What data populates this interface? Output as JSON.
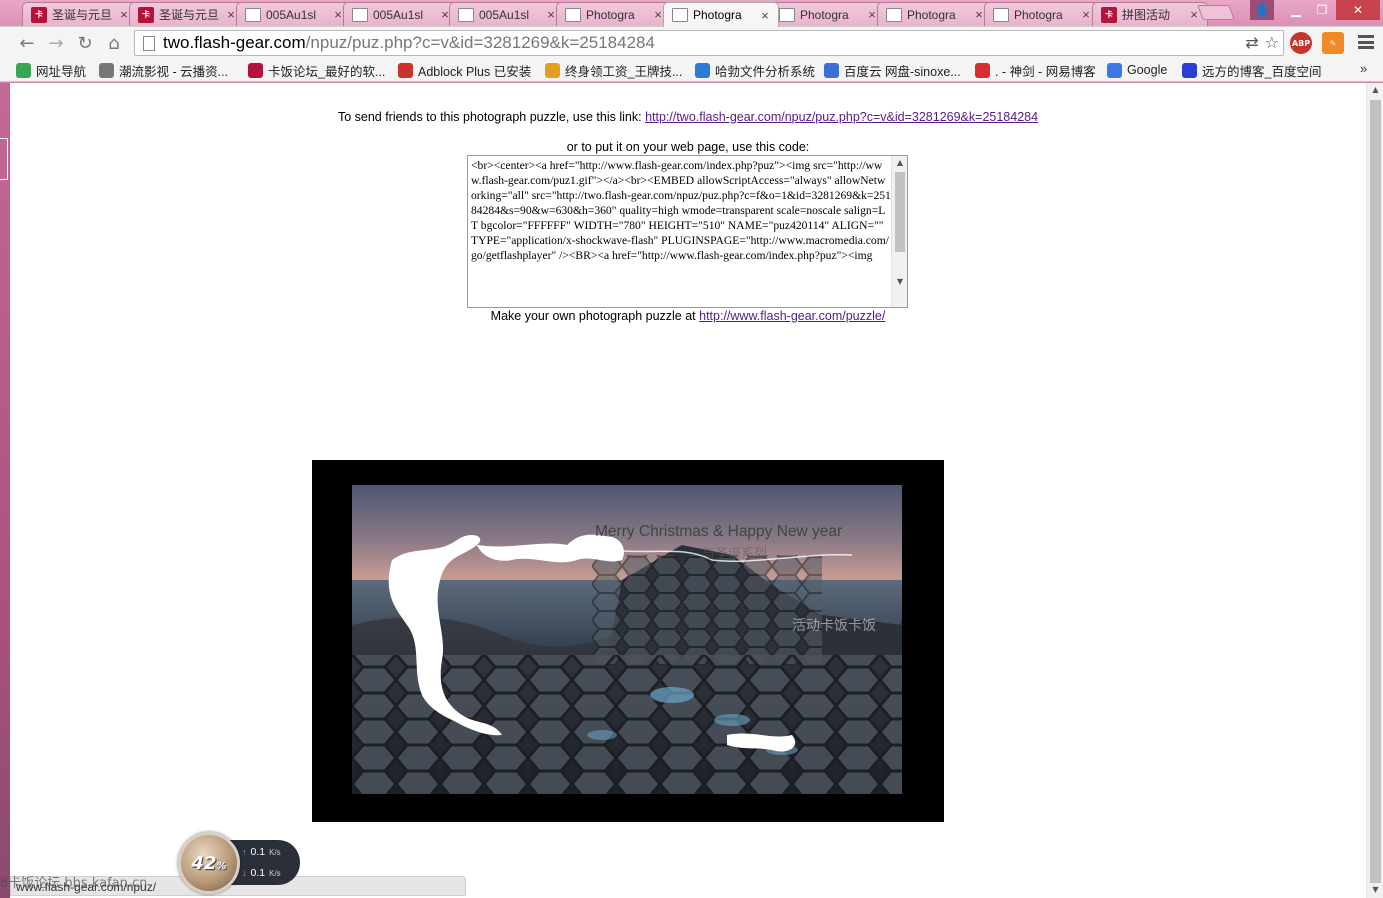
{
  "browser": {
    "tabs": [
      {
        "title": "圣诞与元旦",
        "icon": "red",
        "active": false
      },
      {
        "title": "圣诞与元旦",
        "icon": "red",
        "active": false
      },
      {
        "title": "005Au1sl",
        "icon": "doc",
        "active": false
      },
      {
        "title": "005Au1sl",
        "icon": "doc",
        "active": false
      },
      {
        "title": "005Au1sl",
        "icon": "doc",
        "active": false
      },
      {
        "title": "Photogra",
        "icon": "doc",
        "active": false
      },
      {
        "title": "Photogra",
        "icon": "doc",
        "active": true
      },
      {
        "title": "Photogra",
        "icon": "doc",
        "active": false
      },
      {
        "title": "Photogra",
        "icon": "doc",
        "active": false
      },
      {
        "title": "Photogra",
        "icon": "doc",
        "active": false
      },
      {
        "title": "拼图活动",
        "icon": "red",
        "active": false
      }
    ],
    "tab_close_glyph": "×",
    "address": {
      "host": "two.flash-gear.com",
      "path": "/npuz/puz.php?c=v&id=3281269&k=25184284"
    },
    "bookmarks": [
      {
        "label": "网址导航",
        "icon_color": "#3aa655"
      },
      {
        "label": "潮流影视 - 云播资...",
        "icon_color": "#777777"
      },
      {
        "label": "卡饭论坛_最好的软...",
        "icon_color": "#b3133b"
      },
      {
        "label": "Adblock Plus 已安装",
        "icon_color": "#c8332b"
      },
      {
        "label": "终身领工资_王牌技...",
        "icon_color": "#e0a020"
      },
      {
        "label": "哈勃文件分析系统",
        "icon_color": "#2a7ad6"
      },
      {
        "label": "百度云 网盘-sinoxe...",
        "icon_color": "#3b6fd3"
      },
      {
        "label": ". - 神剑 - 网易博客",
        "icon_color": "#d62f2f"
      },
      {
        "label": "Google",
        "icon_color": "#3b78e7"
      },
      {
        "label": "远方的博客_百度空间",
        "icon_color": "#2a3fd0"
      }
    ],
    "bookmarks_more": "»",
    "abp_label": "ABP"
  },
  "page": {
    "send_prefix": "To send friends to this photograph puzzle, use this link: ",
    "send_link": "http://two.flash-gear.com/npuz/puz.php?c=v&id=3281269&k=25184284",
    "code_caption": "or to put it on your web page, use this code:",
    "embed_code": "<br><center><a href=\"http://www.flash-gear.com/index.php?puz\"><img src=\"http://www.flash-gear.com/puz1.gif\"></a><br><EMBED allowScriptAccess=\"always\" allowNetworking=\"all\" src=\"http://two.flash-gear.com/npuz/puz.php?c=f&o=1&id=3281269&k=25184284&s=90&w=630&h=360\" quality=high wmode=transparent scale=noscale salign=LT bgcolor=\"FFFFFF\" WIDTH=\"780\" HEIGHT=\"510\" NAME=\"puz420114\" ALIGN=\"\" TYPE=\"application/x-shockwave-flash\" PLUGINSPAGE=\"http://www.macromedia.com/go/getflashplayer\" /><BR><a href=\"http://www.flash-gear.com/index.php?puz\"><img",
    "make_own_prefix": "Make your own photograph puzzle at ",
    "make_own_link": "http://www.flash-gear.com/puzzle/"
  },
  "puzzle": {
    "caption": "Merry Christmas & Happy New year",
    "caption_sub": "与圣诞系列",
    "side_caption": "活动卡饭卡饭"
  },
  "status": {
    "url": "www.flash-gear.com/npuz/",
    "watermark": "8卡饭论坛 bbs.kafan.cn"
  },
  "speed_widget": {
    "percent": "42",
    "percent_sign": "%",
    "upload": "0.1",
    "download": "0.1",
    "unit": "K/s"
  }
}
